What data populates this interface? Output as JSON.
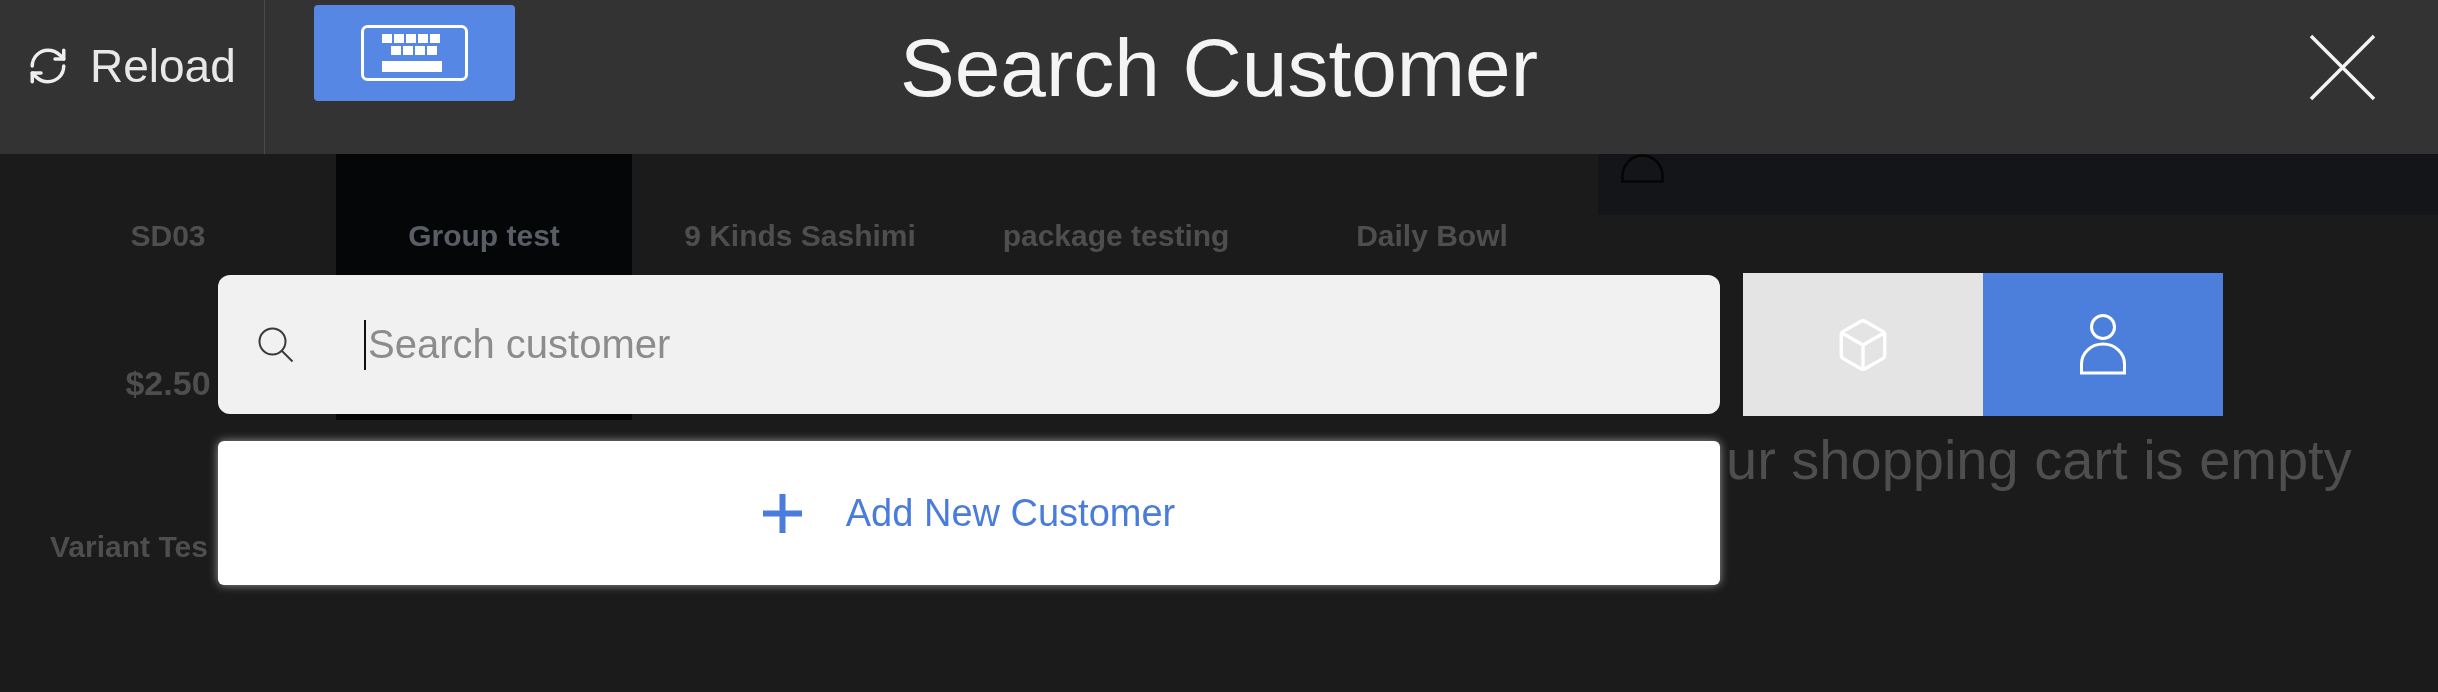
{
  "top_bar": {
    "reload_label": "Reload",
    "title": "Search Customer"
  },
  "product_rows": [
    [
      {
        "name": "SD03",
        "price": "$2.50",
        "selected": false
      },
      {
        "name": "Group test",
        "selected": true
      },
      {
        "name": "9 Kinds Sashimi",
        "selected": false
      },
      {
        "name": "package testing",
        "selected": false
      },
      {
        "name": "Daily Bowl",
        "selected": false
      }
    ],
    [
      {
        "name": "Variant Tes",
        "selected": false
      }
    ]
  ],
  "cart": {
    "empty_message": "ur shopping cart is empty"
  },
  "search": {
    "placeholder": "Search customer"
  },
  "add_customer": {
    "label": "Add New Customer"
  },
  "mode_toggle": [
    {
      "kind": "product",
      "selected": false
    },
    {
      "kind": "customer",
      "selected": true
    }
  ]
}
